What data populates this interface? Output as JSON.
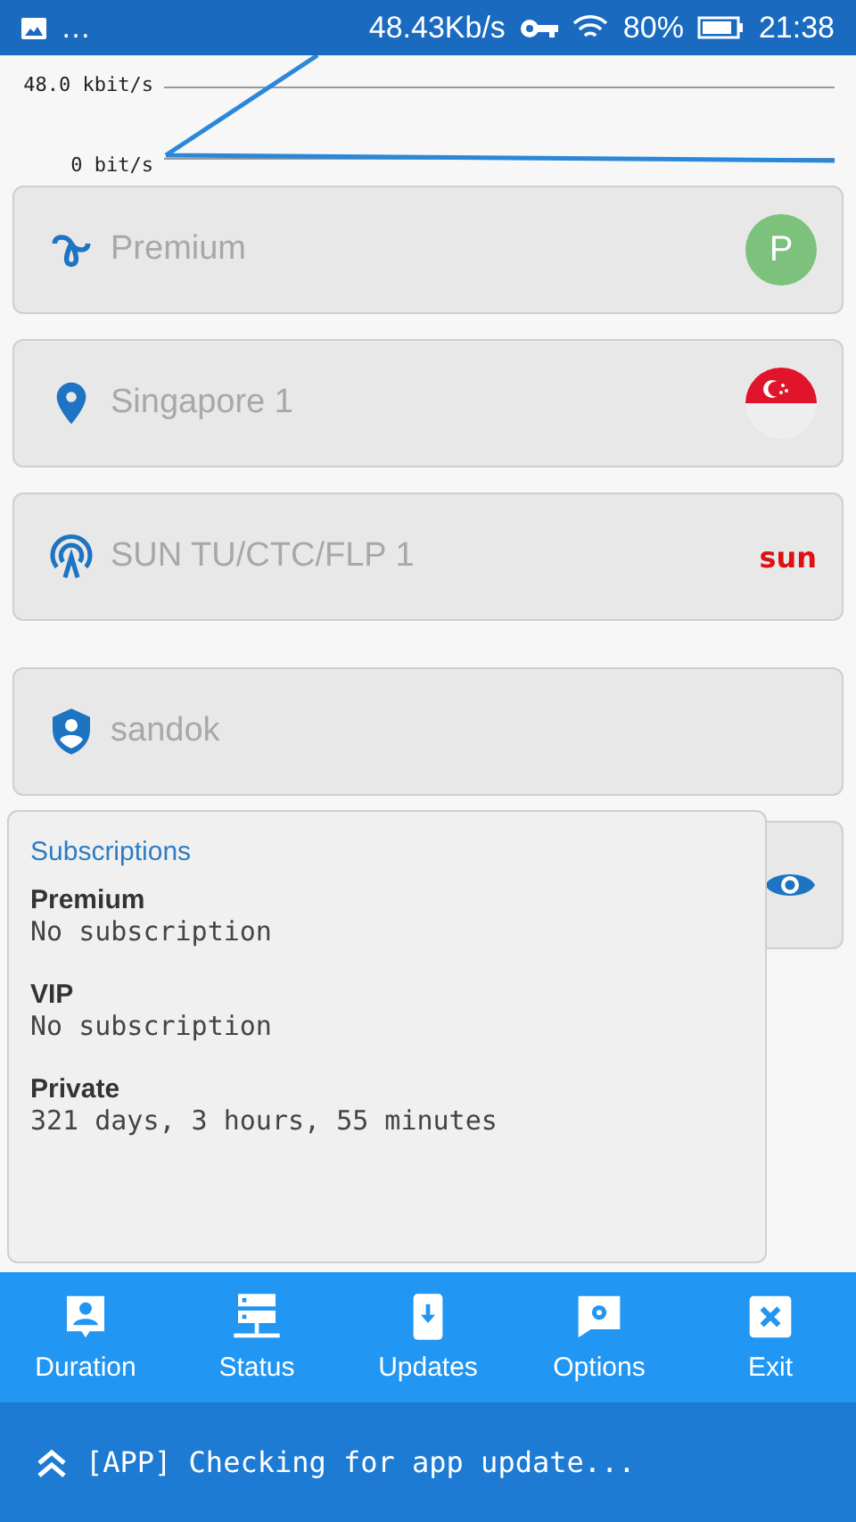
{
  "status_bar": {
    "left": "…",
    "speed": "48.43Kb/s",
    "battery": "80%",
    "time": "21:38"
  },
  "graph": {
    "tick_labels": [
      "48.0 kbit/s",
      "0 bit/s"
    ]
  },
  "cards": [
    {
      "kind": "plan",
      "text": "Premium",
      "badge": {
        "kind": "letter",
        "text": "P"
      }
    },
    {
      "kind": "location",
      "text": "Singapore 1",
      "badge": {
        "kind": "flag"
      }
    },
    {
      "kind": "network",
      "text": "SUN TU/CTC/FLP 1",
      "badge": {
        "kind": "logo",
        "text": "sun"
      }
    },
    {
      "kind": "user",
      "text": "sandok"
    },
    {
      "kind": "password",
      "action": {
        "kind": "eye"
      }
    }
  ],
  "subscriptions": {
    "title": "Subscriptions",
    "items": [
      {
        "name": "Premium",
        "value": "No subscription"
      },
      {
        "name": "VIP",
        "value": "No subscription"
      },
      {
        "name": "Private",
        "value": "321 days, 3 hours, 55 minutes"
      }
    ]
  },
  "nav": [
    {
      "kind": "duration",
      "label": "Duration"
    },
    {
      "kind": "status",
      "label": "Status"
    },
    {
      "kind": "updates",
      "label": "Updates"
    },
    {
      "kind": "options",
      "label": "Options"
    },
    {
      "kind": "exit",
      "label": "Exit"
    }
  ],
  "log": "[APP] Checking for app update..."
}
